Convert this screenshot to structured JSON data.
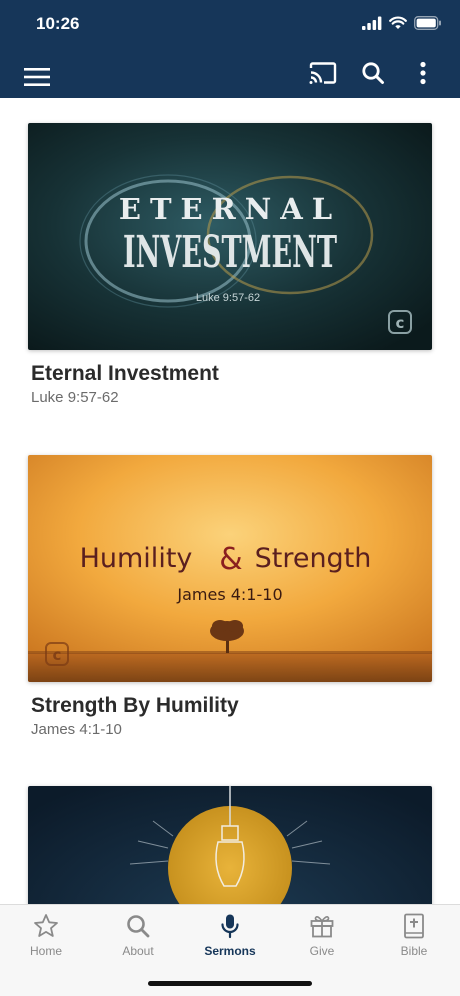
{
  "status_bar": {
    "time": "10:26"
  },
  "app_bar": {
    "icons": [
      "menu-icon",
      "cast-icon",
      "search-icon",
      "more-vert-icon"
    ]
  },
  "sermons": [
    {
      "title": "Eternal Investment",
      "reference": "Luke 9:57-62",
      "art": {
        "line1": "ETERNAL",
        "line2": "INVESTMENT",
        "caption": "Luke 9:57-62"
      }
    },
    {
      "title": "Strength By Humility",
      "reference": "James 4:1-10",
      "art": {
        "line1": "Humility",
        "amp": "&",
        "line2": "Strength",
        "caption": "James 4:1-10"
      }
    }
  ],
  "tabs": [
    {
      "label": "Home",
      "icon": "star-icon",
      "active": false
    },
    {
      "label": "About",
      "icon": "search-icon",
      "active": false
    },
    {
      "label": "Sermons",
      "icon": "microphone-icon",
      "active": true
    },
    {
      "label": "Give",
      "icon": "gift-icon",
      "active": false
    },
    {
      "label": "Bible",
      "icon": "bible-icon",
      "active": false
    }
  ],
  "colors": {
    "header": "#163659",
    "tab_active": "#163659",
    "tab_inactive": "#8a8a8a"
  }
}
